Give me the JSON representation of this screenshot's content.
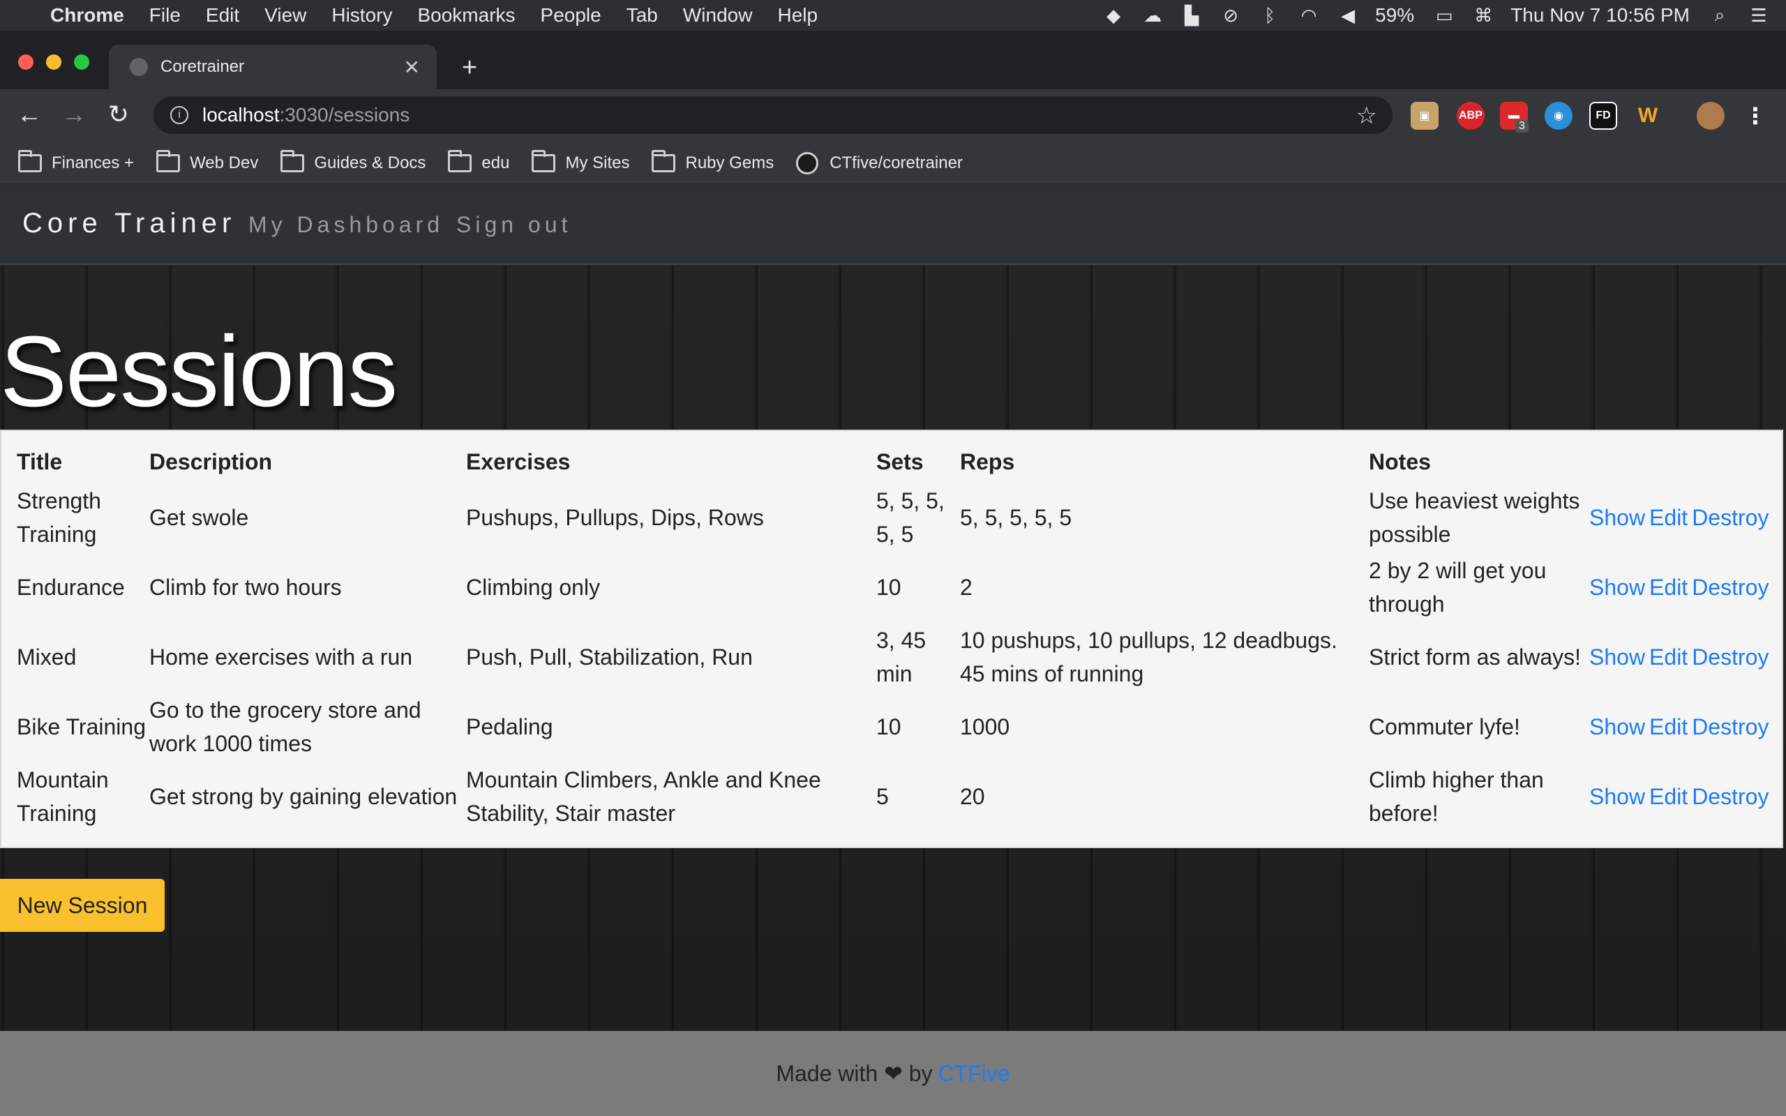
{
  "menubar": {
    "app": "Chrome",
    "items": [
      "File",
      "Edit",
      "View",
      "History",
      "Bookmarks",
      "People",
      "Tab",
      "Window",
      "Help"
    ],
    "battery": "59%",
    "datetime": "Thu Nov 7  10:56 PM"
  },
  "tab": {
    "title": "Coretrainer"
  },
  "address": {
    "host": "localhost",
    "path": ":3030/sessions"
  },
  "extensions": {
    "badge_count": "3",
    "abp": "ABP",
    "fd": "FD",
    "w": "W"
  },
  "bookmarks": [
    "Finances +",
    "Web Dev",
    "Guides & Docs",
    "edu",
    "My Sites",
    "Ruby Gems"
  ],
  "bookmark_github": "CTfive/coretrainer",
  "app": {
    "brand": "Core Trainer",
    "nav": [
      "My Dashboard",
      "Sign out"
    ],
    "heading": "Sessions",
    "table": {
      "headers": [
        "Title",
        "Description",
        "Exercises",
        "Sets",
        "Reps",
        "Notes"
      ],
      "rows": [
        {
          "title": "Strength Training",
          "description": "Get swole",
          "exercises": "Pushups, Pullups, Dips, Rows",
          "sets": "5, 5, 5, 5, 5",
          "reps": "5, 5, 5, 5, 5",
          "notes": "Use heaviest weights possible"
        },
        {
          "title": "Endurance",
          "description": "Climb for two hours",
          "exercises": "Climbing only",
          "sets": "10",
          "reps": "2",
          "notes": "2 by 2 will get you through"
        },
        {
          "title": "Mixed",
          "description": "Home exercises with a run",
          "exercises": "Push, Pull, Stabilization, Run",
          "sets": "3, 45 min",
          "reps": "10 pushups, 10 pullups, 12 deadbugs. 45 mins of running",
          "notes": "Strict form as always!"
        },
        {
          "title": "Bike Training",
          "description": "Go to the grocery store and work 1000 times",
          "exercises": "Pedaling",
          "sets": "10",
          "reps": "1000",
          "notes": "Commuter lyfe!"
        },
        {
          "title": "Mountain Training",
          "description": "Get strong by gaining elevation",
          "exercises": "Mountain Climbers, Ankle and Knee Stability, Stair master",
          "sets": "5",
          "reps": "20",
          "notes": "Climb higher than before!"
        }
      ],
      "actions": [
        "Show",
        "Edit",
        "Destroy"
      ]
    },
    "new_button": "New Session",
    "footer": {
      "text": "Made with ❤ by",
      "link": "CTFive"
    }
  }
}
